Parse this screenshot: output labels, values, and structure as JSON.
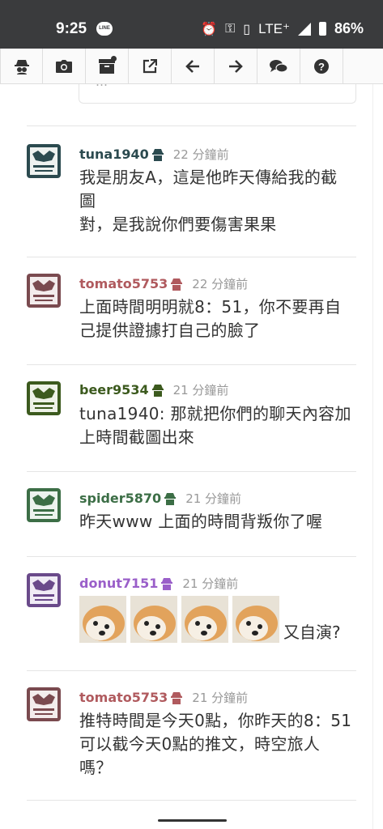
{
  "status_bar": {
    "time": "9:25",
    "line_icon": "LINE",
    "network": "LTE⁺",
    "battery": "86%"
  },
  "toolbar": {
    "icons": [
      "spy-icon",
      "camera-icon",
      "archive-icon",
      "external-link-icon",
      "arrow-left-icon",
      "arrow-right-icon",
      "chat-icon",
      "help-icon"
    ]
  },
  "previous_snippet": "…",
  "comments": [
    {
      "user": "tuna1940",
      "color": "#2b4a4f",
      "ago": "22 分鐘前",
      "lines": [
        "我是朋友A，這是他昨天傳給我的截",
        "圖",
        "對，是我說你們要傷害果果"
      ]
    },
    {
      "user": "tomato5753",
      "color": "#b05a5e",
      "ago": "22 分鐘前",
      "lines": [
        "上面時間明明就8：51，你不要再自",
        "己提供證據打自己的臉了"
      ]
    },
    {
      "user": "beer9534",
      "color": "#3c5a1e",
      "ago": "21 分鐘前",
      "lines": [
        "tuna1940: 那就把你們的聊天內容加",
        "上時間截圖出來"
      ]
    },
    {
      "user": "spider5870",
      "color": "#3c6e46",
      "ago": "21 分鐘前",
      "lines": [
        "昨天www 上面的時間背叛你了喔"
      ]
    },
    {
      "user": "donut7151",
      "color": "#9a5fc9",
      "ago": "21 分鐘前",
      "caption": "又自演?"
    },
    {
      "user": "tomato5753",
      "color": "#b05a5e",
      "ago": "21 分鐘前",
      "lines": [
        "推特時間是今天0點，你昨天的8：51",
        "可以截今天0點的推文，時空旅人",
        "嗎？"
      ]
    }
  ]
}
